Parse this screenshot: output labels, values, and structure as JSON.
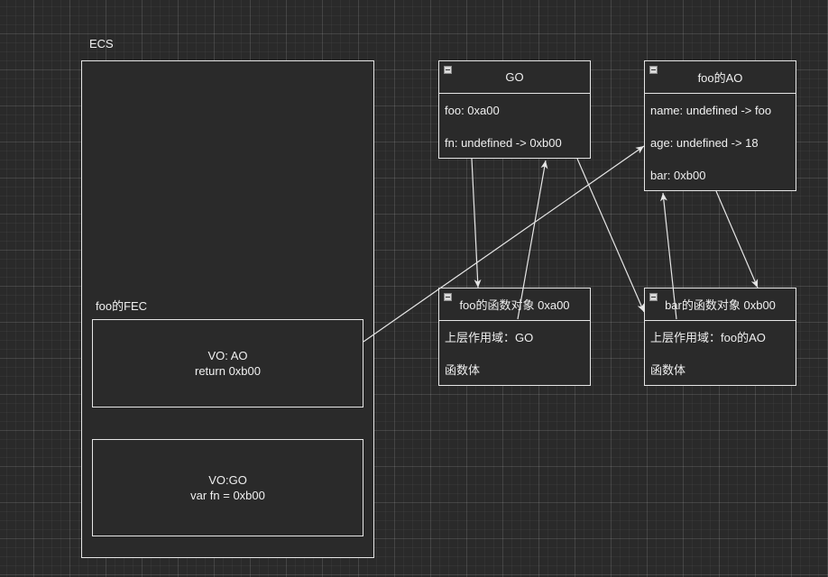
{
  "ecs": {
    "label": "ECS"
  },
  "fec": {
    "label": "foo的FEC",
    "ao_frame": {
      "line1": "VO: AO",
      "line2": "return 0xb00"
    },
    "go_frame": {
      "line1": "VO:GO",
      "line2": "var fn =  0xb00"
    }
  },
  "go": {
    "title": "GO",
    "rows": [
      "foo: 0xa00",
      "fn: undefined -> 0xb00"
    ]
  },
  "foo_ao": {
    "title": "foo的AO",
    "rows": [
      "name: undefined  -> foo",
      "age: undefined -> 18",
      "bar: 0xb00"
    ]
  },
  "foo_func": {
    "title": "foo的函数对象 0xa00",
    "rows": [
      "上层作用域：GO",
      "函数体"
    ]
  },
  "bar_func": {
    "title": "bar的函数对象 0xb00",
    "rows": [
      "上层作用域：foo的AO",
      "函数体"
    ]
  },
  "colors": {
    "background": "#2a2a2a",
    "stroke": "#e6e6e6",
    "text": "#f0f0f0"
  }
}
